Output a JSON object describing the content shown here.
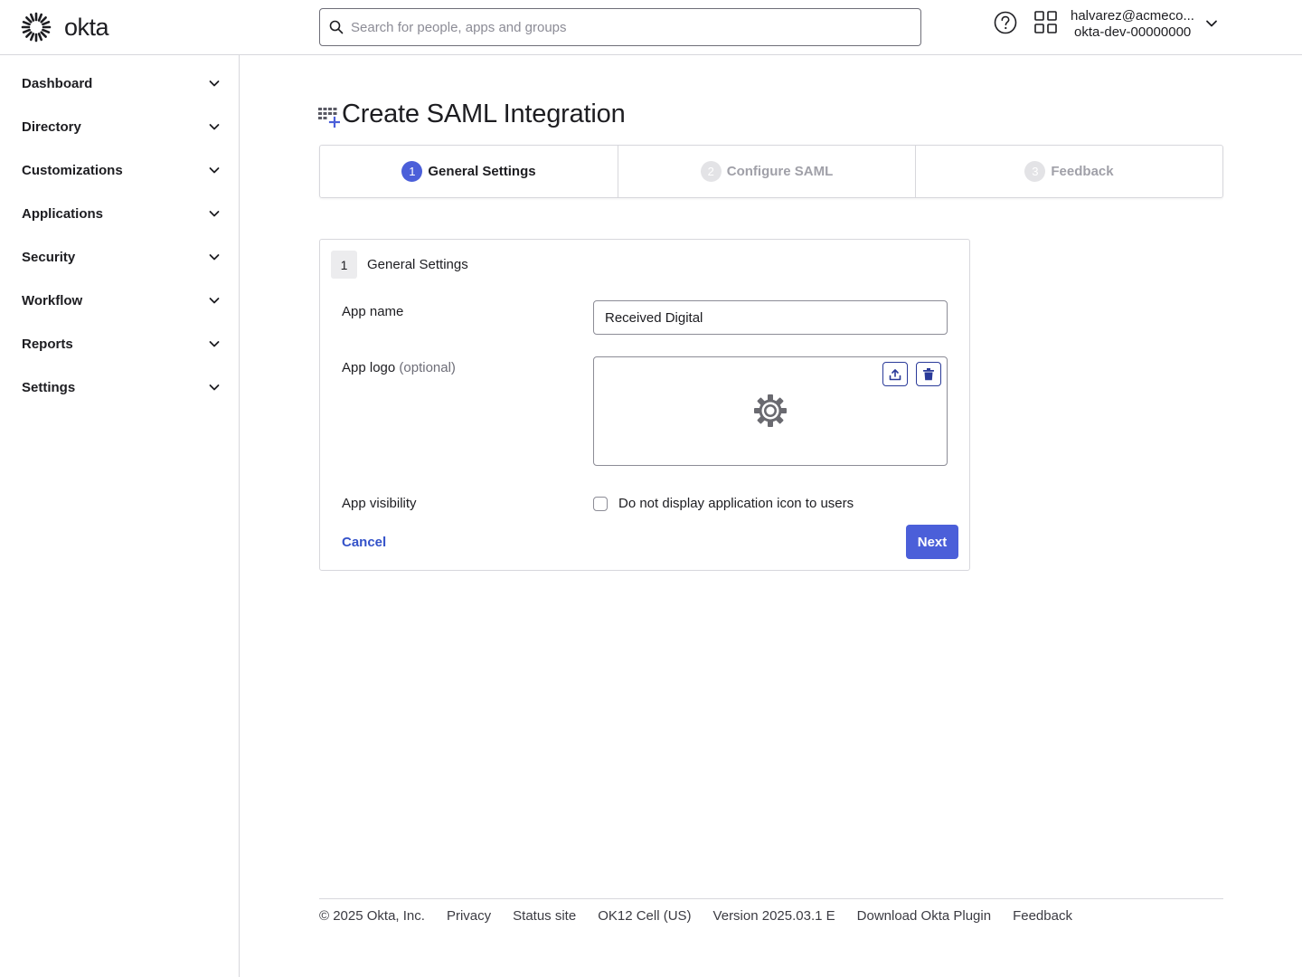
{
  "header": {
    "brand": "okta",
    "search_placeholder": "Search for people, apps and groups",
    "user_email": "halvarez@acmeco...",
    "user_org": "okta-dev-00000000"
  },
  "sidebar": {
    "items": [
      {
        "label": "Dashboard"
      },
      {
        "label": "Directory"
      },
      {
        "label": "Customizations"
      },
      {
        "label": "Applications"
      },
      {
        "label": "Security"
      },
      {
        "label": "Workflow"
      },
      {
        "label": "Reports"
      },
      {
        "label": "Settings"
      }
    ]
  },
  "page": {
    "title": "Create SAML Integration"
  },
  "steps": [
    {
      "num": "1",
      "label": "General Settings",
      "state": "active"
    },
    {
      "num": "2",
      "label": "Configure SAML",
      "state": "inactive"
    },
    {
      "num": "3",
      "label": "Feedback",
      "state": "inactive"
    }
  ],
  "form": {
    "section_num": "1",
    "section_title": "General Settings",
    "app_name_label": "App name",
    "app_name_value": "Received Digital",
    "app_logo_label": "App logo",
    "app_logo_optional": "(optional)",
    "app_visibility_label": "App visibility",
    "visibility_checkbox_label": "Do not display application icon to users",
    "visibility_checked": false,
    "cancel_label": "Cancel",
    "next_label": "Next"
  },
  "footer": {
    "copyright": "© 2025 Okta, Inc.",
    "privacy": "Privacy",
    "status_site": "Status site",
    "cell": "OK12 Cell (US)",
    "version": "Version 2025.03.1 E",
    "download_plugin": "Download Okta Plugin",
    "feedback": "Feedback"
  },
  "colors": {
    "accent": "#4b5fd9",
    "link": "#3452c9",
    "border": "#d7d7dc",
    "text": "#1d1d21"
  },
  "icons": [
    "okta-logo-icon",
    "search-icon",
    "help-icon",
    "apps-grid-icon",
    "chevron-down-icon",
    "create-app-icon",
    "upload-icon",
    "trash-icon",
    "gear-icon"
  ]
}
